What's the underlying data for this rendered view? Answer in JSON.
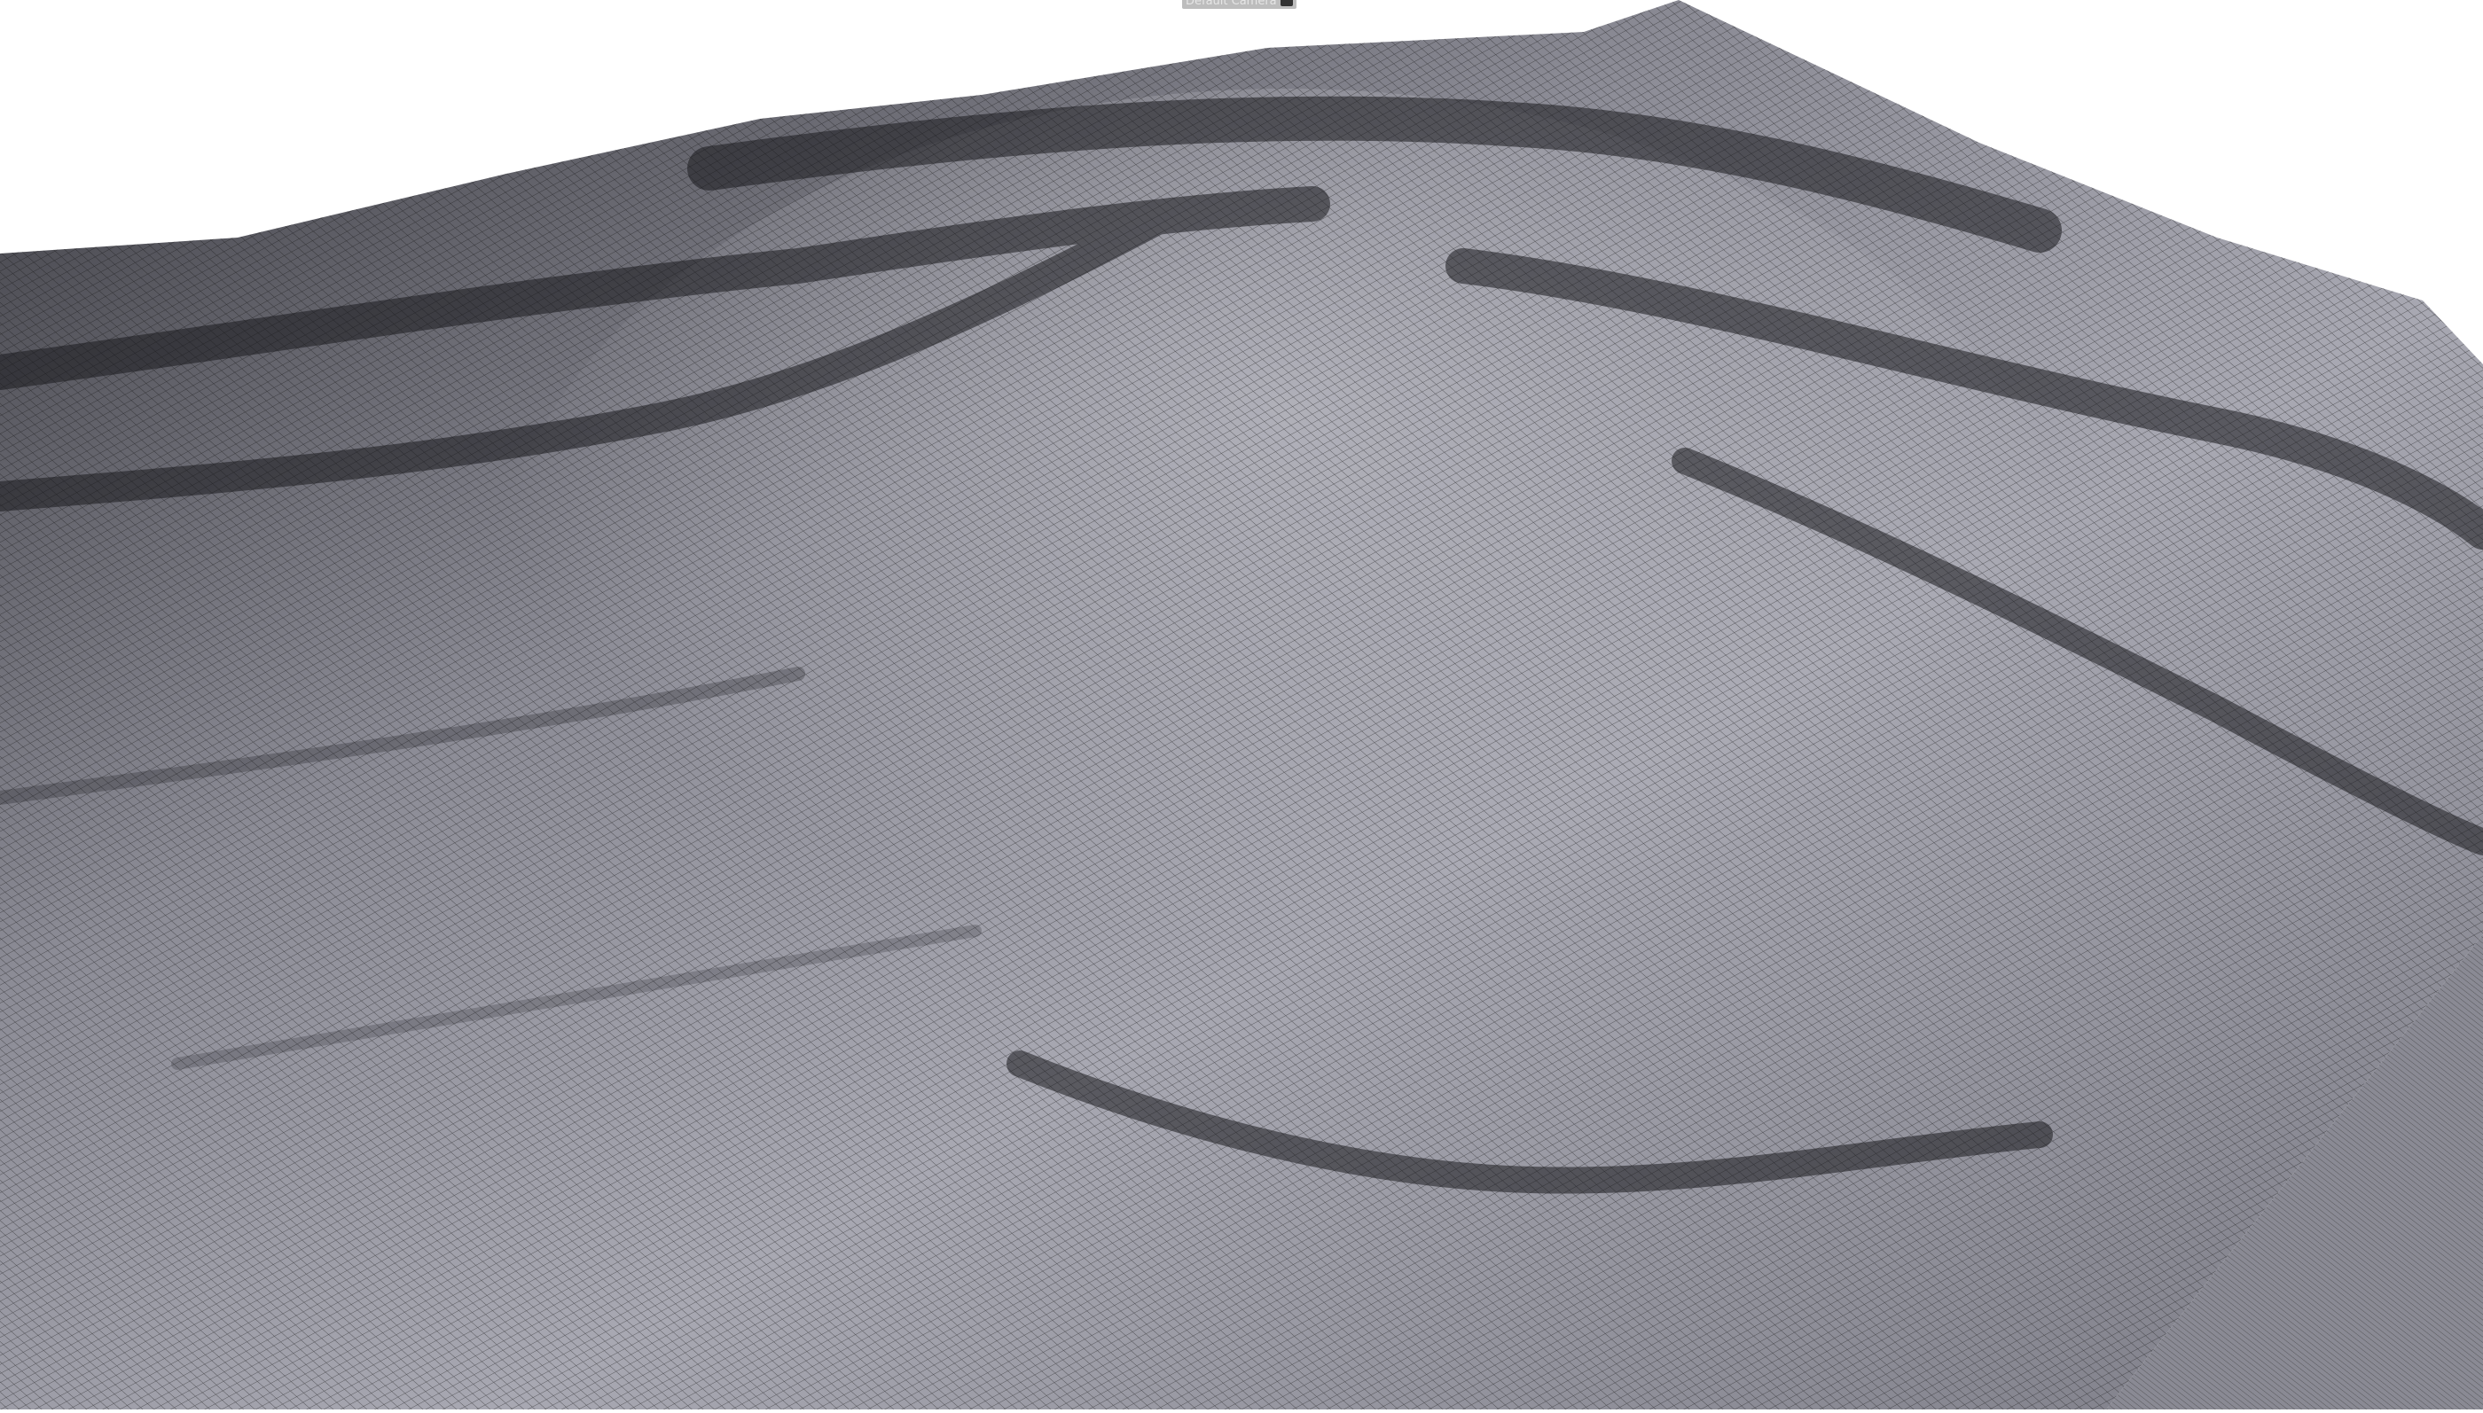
{
  "viewport": {
    "camera_label": "Default Camera",
    "camera_icon": "camera-icon",
    "mesh_color": "#6e6e78",
    "wire_color": "#111111",
    "side_color": "#8a8a94"
  }
}
